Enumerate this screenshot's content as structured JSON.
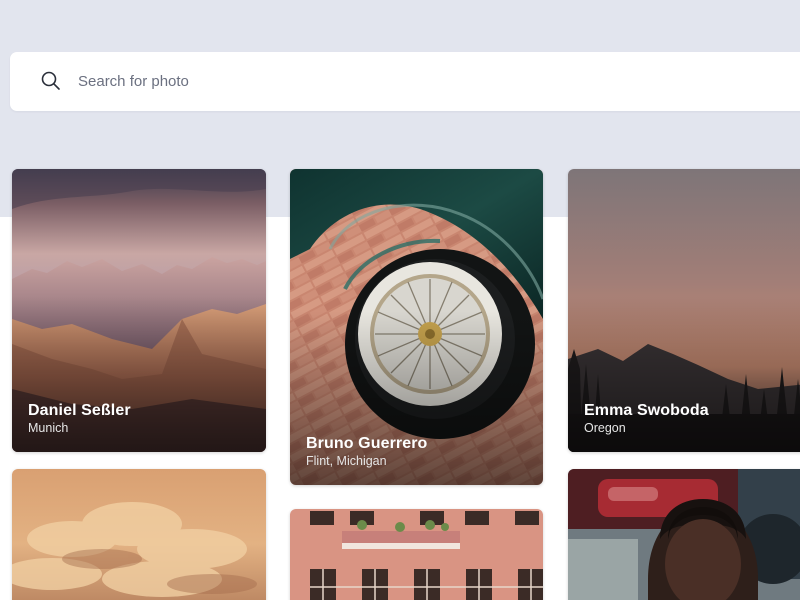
{
  "search": {
    "placeholder": "Search for photo",
    "icon": "search-icon"
  },
  "colors": {
    "page_top_band": "#e2e5ee",
    "search_background": "#ffffff",
    "placeholder_text": "#6b7080"
  },
  "photos": [
    {
      "name": "Daniel Seßler",
      "location": "Munich"
    },
    {
      "name": "Bruno Guerrero",
      "location": "Flint, Michigan"
    },
    {
      "name": "Emma Swoboda",
      "location": "Oregon"
    }
  ]
}
